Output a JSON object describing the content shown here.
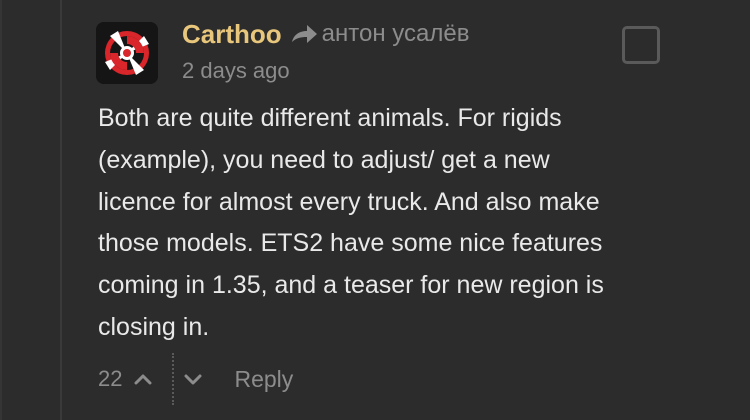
{
  "comment": {
    "author": "Carthoo",
    "reply_to": "антон усалёв",
    "timestamp": "2 days ago",
    "body_lines": [
      "Both are quite different animals. For rigids",
      "(example), you need to adjust/ get a new",
      "licence for almost every truck. And also make",
      "those models. ETS2 have some nice features",
      "coming in 1.35, and a teaser for new region is",
      "closing in."
    ],
    "votes": "22",
    "reply_label": "Reply"
  },
  "icons": {
    "avatar": "red-spiral-logo",
    "reply_arrow": "reply-arrow-icon",
    "checkbox": "checkbox-icon",
    "upvote": "chevron-up-icon",
    "downvote": "chevron-down-icon"
  },
  "colors": {
    "background": "#2c2c2c",
    "author": "#e8c77c",
    "meta": "#8c8c8c",
    "body": "#e9e9e9",
    "avatar_accent": "#d8262b"
  }
}
